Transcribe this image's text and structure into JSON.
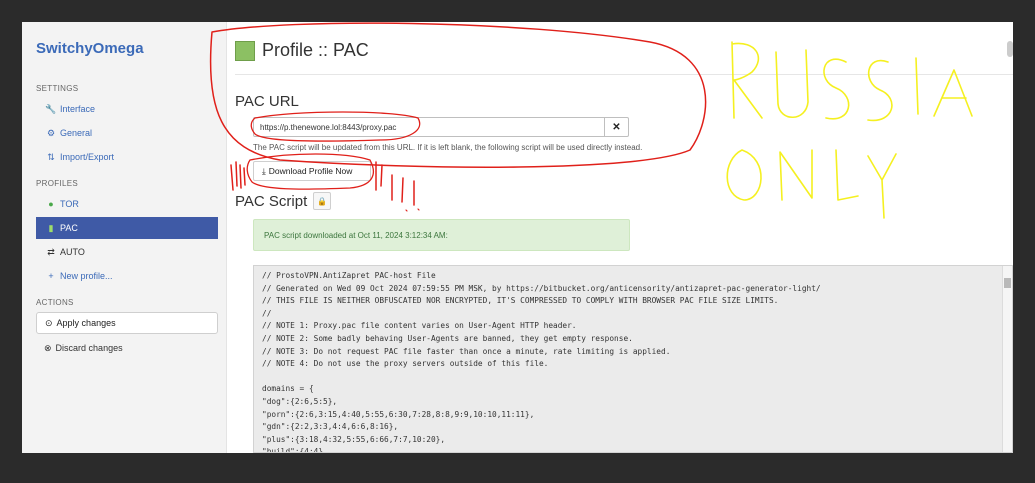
{
  "app": {
    "title": "SwitchyOmega"
  },
  "sidebar": {
    "settings_label": "SETTINGS",
    "settings_items": [
      {
        "label": "Interface",
        "icon": "wrench-icon"
      },
      {
        "label": "General",
        "icon": "gear-icon"
      },
      {
        "label": "Import/Export",
        "icon": "import-export-icon"
      }
    ],
    "profiles_label": "PROFILES",
    "profiles": [
      {
        "label": "TOR",
        "icon": "globe-icon",
        "active": false
      },
      {
        "label": "PAC",
        "icon": "file-icon",
        "active": true
      },
      {
        "label": "AUTO",
        "icon": "switch-icon",
        "active": false
      },
      {
        "label": "New profile...",
        "icon": "plus-icon",
        "active": false
      }
    ],
    "actions_label": "ACTIONS",
    "apply_label": "Apply changes",
    "discard_label": "Discard changes"
  },
  "profile": {
    "title": "Profile :: PAC",
    "color": "#8cc063"
  },
  "pac_url": {
    "heading": "PAC URL",
    "value": "https://p.thenewone.lol:8443/proxy.pac",
    "help": "The PAC script will be updated from this URL. If it is left blank, the following script will be used directly instead.",
    "download_label": "Download Profile Now"
  },
  "pac_script": {
    "heading": "PAC Script",
    "alert": "PAC script downloaded at Oct 11, 2024 3:12:34 AM:",
    "lines": [
      "// ProstoVPN.AntiZapret PAC-host File",
      "// Generated on Wed 09 Oct 2024 07:59:55 PM MSK, by https://bitbucket.org/anticensority/antizapret-pac-generator-light/",
      "// THIS FILE IS NEITHER OBFUSCATED NOR ENCRYPTED, IT'S COMPRESSED TO COMPLY WITH BROWSER PAC FILE SIZE LIMITS.",
      "//",
      "// NOTE 1: Proxy.pac file content varies on User-Agent HTTP header.",
      "// NOTE 2: Some badly behaving User-Agents are banned, they get empty response.",
      "// NOTE 3: Do not request PAC file faster than once a minute, rate limiting is applied.",
      "// NOTE 4: Do not use the proxy servers outside of this file.",
      "",
      "domains = {",
      "\"dog\":{2:6,5:5},",
      "\"porn\":{2:6,3:15,4:40,5:55,6:30,7:28,8:8,9:9,10:10,11:11},",
      "\"gdn\":{2:2,3:3,4:4,6:6,8:16},",
      "\"plus\":{3:18,4:32,5:55,6:66,7:7,10:20},",
      "\"build\":{4:4},"
    ]
  },
  "annotation": {
    "text": "RUSSIA ONLY",
    "highlight_color": "#e0201a",
    "text_color": "#f5f020"
  }
}
